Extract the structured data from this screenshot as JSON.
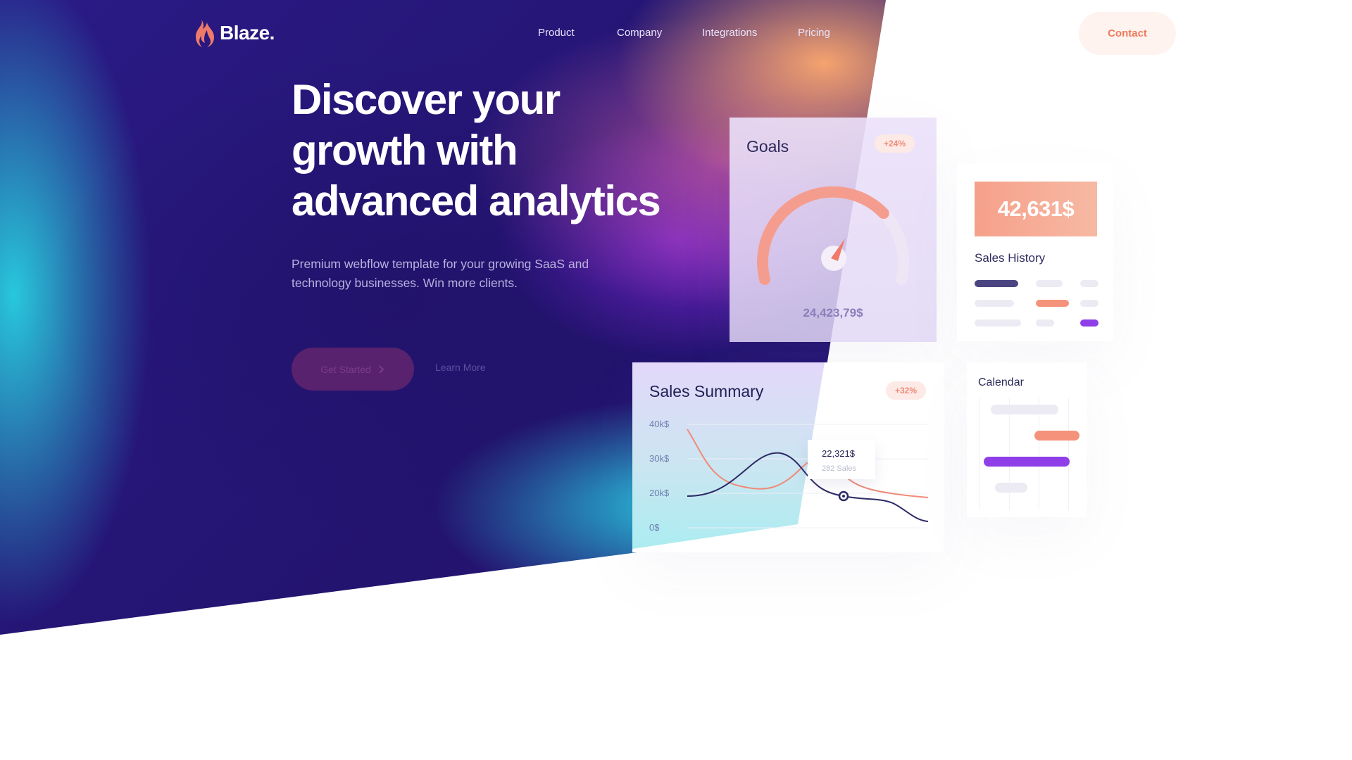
{
  "brand": {
    "name": "Blaze.",
    "logo_icon": "flame-icon",
    "logo_colors": [
      "#f08a6e",
      "#e8586c"
    ]
  },
  "nav": {
    "links": [
      {
        "label": "Product"
      },
      {
        "label": "Company"
      },
      {
        "label": "Integrations"
      },
      {
        "label": "Pricing"
      }
    ],
    "contact_label": "Contact"
  },
  "hero": {
    "headline_lines": [
      "Discover your",
      "growth with",
      "advanced analytics"
    ],
    "subtext": "Premium webflow template for your growing SaaS and technology businesses. Win more clients.",
    "primary_cta": "Get Started",
    "primary_cta_icon": "chevron-right-icon",
    "secondary_cta": "Learn More"
  },
  "goals": {
    "title": "Goals",
    "badge": "+24%",
    "value": "24,423,79$",
    "gauge_progress": 0.72
  },
  "sales_history": {
    "amount": "42,631$",
    "title": "Sales History"
  },
  "sales_summary": {
    "title": "Sales Summary",
    "badge": "+32%",
    "y_ticks": [
      "40k$",
      "30k$",
      "20k$",
      "0$"
    ],
    "tooltip_value": "22,321$",
    "tooltip_sub": "282 Sales"
  },
  "calendar": {
    "title": "Calendar"
  },
  "colors": {
    "accent": "#ef7a5e",
    "navy": "#2b2a63",
    "purple": "#8f3fe8",
    "coral": "#f5927c"
  }
}
